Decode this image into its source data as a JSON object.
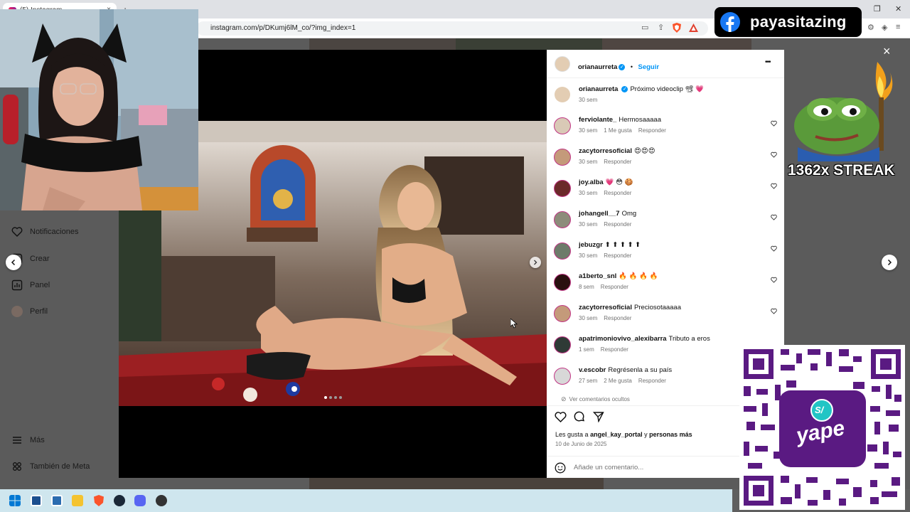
{
  "browser": {
    "tab_title": "(5) Instagram",
    "tab_close": "×",
    "new_tab": "+",
    "url": "instagram.com/p/DKumj6lM_co/?img_index=1"
  },
  "sidebar": {
    "items": [
      {
        "label": "Notificaciones",
        "icon": "heart-icon"
      },
      {
        "label": "Crear",
        "icon": "plus-square-icon"
      },
      {
        "label": "Panel",
        "icon": "bar-chart-icon"
      },
      {
        "label": "Perfil",
        "icon": "profile-icon"
      },
      {
        "label": "Más",
        "icon": "menu-icon"
      },
      {
        "label": "También de Meta",
        "icon": "meta-icon"
      }
    ]
  },
  "post": {
    "author": "orianaurreta",
    "follow_label": "Seguir",
    "separator": "•",
    "more": "•••",
    "caption_text": "Próximo videoclip 📽 💗",
    "caption_time": "30 sem",
    "likes_prefix": "Les gusta a",
    "likes_user": "angel_kay_portal",
    "likes_conj": "y",
    "likes_suffix": "personas más",
    "date": "10 de Junio de 2025",
    "add_comment_placeholder": "Añade un comentario...",
    "view_hidden": "Ver comentarios ocultos",
    "close": "×"
  },
  "comments": [
    {
      "user": "ferviolante_",
      "text": "Hermosaaaaa",
      "time": "30 sem",
      "likes": "1 Me gusta",
      "reply": "Responder",
      "avatar_color": "#d9c9b6"
    },
    {
      "user": "zacytorresoficial",
      "text": "😍😍😍",
      "time": "30 sem",
      "likes": "",
      "reply": "Responder",
      "avatar_color": "#c49a7a"
    },
    {
      "user": "joy.alba",
      "text": "💗 😳 🍪",
      "time": "30 sem",
      "likes": "",
      "reply": "Responder",
      "avatar_color": "#6b2a2a"
    },
    {
      "user": "johangell__7",
      "text": "Omg",
      "time": "30 sem",
      "likes": "",
      "reply": "Responder",
      "avatar_color": "#8c8c7a"
    },
    {
      "user": "jebuzgr",
      "text": "⬆ ⬆ ⬆ ⬆ ⬆",
      "time": "30 sem",
      "likes": "",
      "reply": "Responder",
      "avatar_color": "#6d7b6a"
    },
    {
      "user": "a1berto_snl",
      "text": "🔥 🔥 🔥 🔥",
      "time": "8 sem",
      "likes": "",
      "reply": "Responder",
      "avatar_color": "#2a1010"
    },
    {
      "user": "zacytorresoficial",
      "text": "Preciosotaaaaa",
      "time": "30 sem",
      "likes": "",
      "reply": "Responder",
      "avatar_color": "#c49a7a"
    },
    {
      "user": "apatrimoniovivo_alexibarra",
      "text": "Tributo a eros",
      "time": "1 sem",
      "likes": "",
      "reply": "Responder",
      "avatar_color": "#2f3a36"
    },
    {
      "user": "v.escobr",
      "text": "Regrésenla a su país",
      "time": "27 sem",
      "likes": "2 Me gusta",
      "reply": "Responder",
      "avatar_color": "#d8d8d8"
    }
  ],
  "overlays": {
    "fb_handle": "payasitazing",
    "streak": "1362x STREAK",
    "qr_brand": "yape",
    "qr_badge": "S/"
  },
  "carousel": {
    "dots": 4,
    "active": 0
  },
  "colors": {
    "link_blue": "#0095f6",
    "like_red": "#ff3040",
    "qr_purple": "#5a1a82",
    "fb_blue": "#1877f2"
  }
}
